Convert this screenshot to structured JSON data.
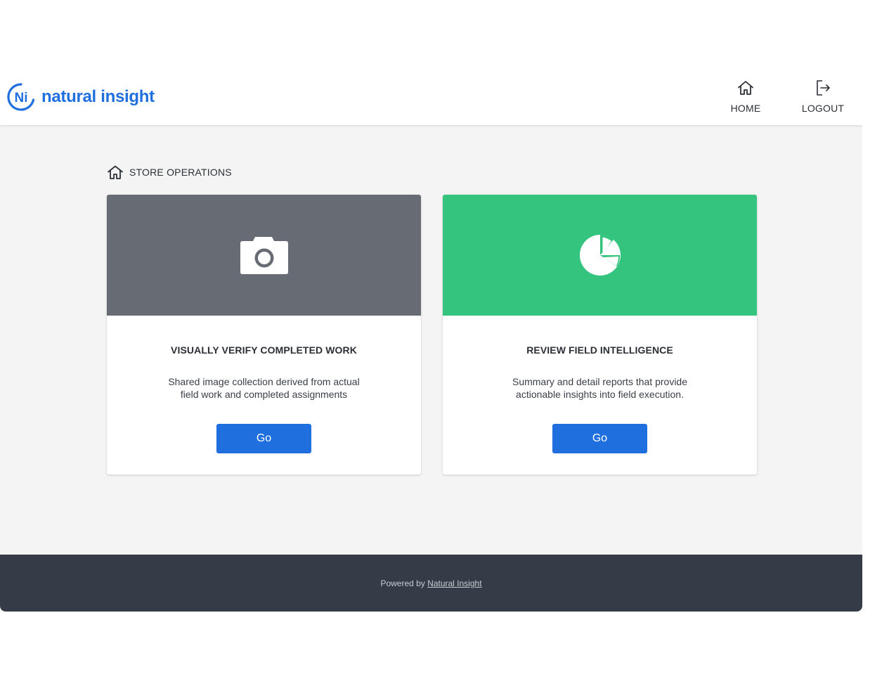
{
  "header": {
    "logo_text": "natural insight",
    "logo_mark_text": "Ni",
    "nav": [
      {
        "label": "HOME",
        "icon": "home-icon"
      },
      {
        "label": "LOGOUT",
        "icon": "logout-icon"
      }
    ]
  },
  "breadcrumb": {
    "icon": "home-icon",
    "label": "STORE OPERATIONS"
  },
  "cards": [
    {
      "icon": "camera-icon",
      "banner_color": "#676b74",
      "title": "VISUALLY VERIFY COMPLETED WORK",
      "description": "Shared image collection derived from actual field work and completed assignments",
      "button_label": "Go"
    },
    {
      "icon": "pie-chart-icon",
      "banner_color": "#34c47e",
      "title": "REVIEW FIELD INTELLIGENCE",
      "description": "Summary and detail reports that provide actionable insights into field execution.",
      "button_label": "Go"
    }
  ],
  "footer": {
    "prefix": "Powered by ",
    "link_text": "Natural Insight"
  },
  "colors": {
    "brand_blue": "#1f6fde",
    "page_bg": "#f4f4f4",
    "footer_bg": "#353c48"
  }
}
